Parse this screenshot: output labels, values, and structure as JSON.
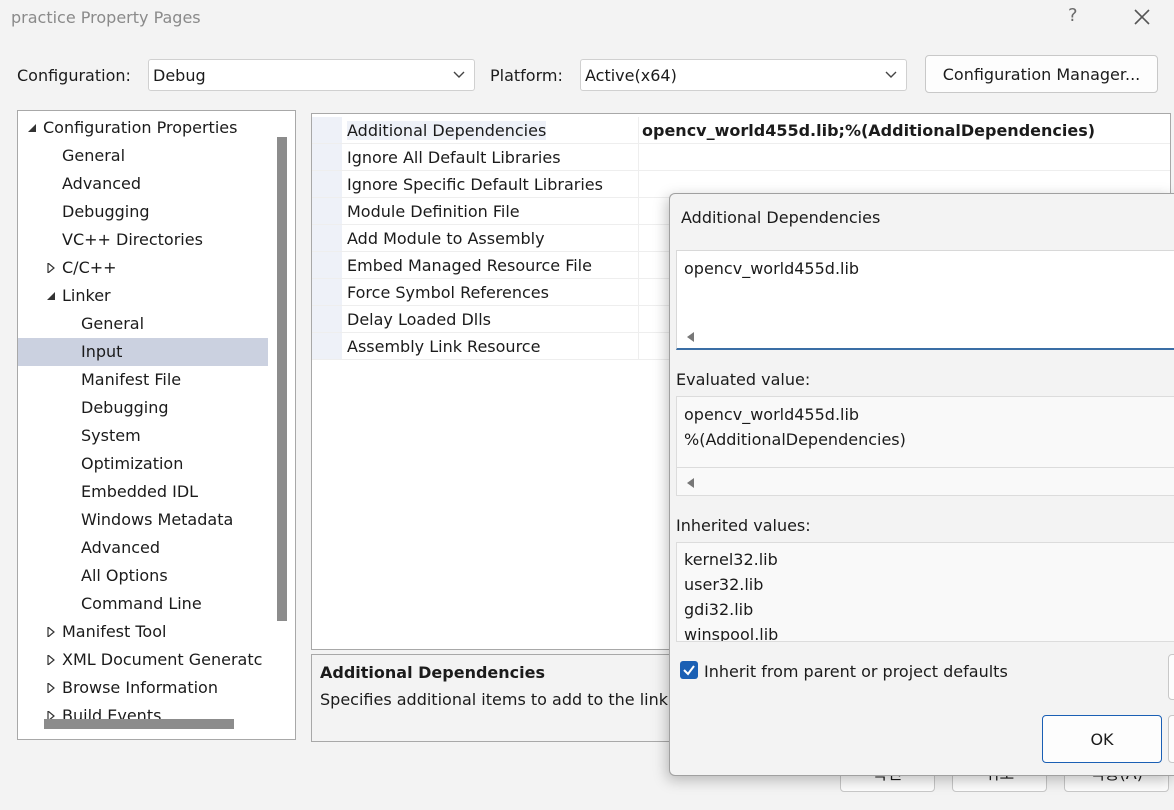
{
  "window": {
    "title": "practice Property Pages",
    "help_glyph": "?",
    "close_icon": "close-icon"
  },
  "config_bar": {
    "configuration_label": "Configuration:",
    "configuration_value": "Debug",
    "platform_label": "Platform:",
    "platform_value": "Active(x64)",
    "config_manager_label": "Configuration Manager..."
  },
  "tree": {
    "items": [
      "Configuration Properties",
      "General",
      "Advanced",
      "Debugging",
      "VC++ Directories",
      "C/C++",
      "Linker",
      "General",
      "Input",
      "Manifest File",
      "Debugging",
      "System",
      "Optimization",
      "Embedded IDL",
      "Windows Metadata",
      "Advanced",
      "All Options",
      "Command Line",
      "Manifest Tool",
      "XML Document Generatc",
      "Browse Information",
      "Build Events"
    ],
    "selected": "Input"
  },
  "grid": {
    "rows": [
      {
        "name": "Additional Dependencies",
        "value": "opencv_world455d.lib;%(AdditionalDependencies)"
      },
      {
        "name": "Ignore All Default Libraries",
        "value": ""
      },
      {
        "name": "Ignore Specific Default Libraries",
        "value": ""
      },
      {
        "name": "Module Definition File",
        "value": ""
      },
      {
        "name": "Add Module to Assembly",
        "value": ""
      },
      {
        "name": "Embed Managed Resource File",
        "value": ""
      },
      {
        "name": "Force Symbol References",
        "value": ""
      },
      {
        "name": "Delay Loaded Dlls",
        "value": ""
      },
      {
        "name": "Assembly Link Resource",
        "value": ""
      }
    ]
  },
  "description": {
    "title": "Additional Dependencies",
    "text": "Specifies additional items to add to the link"
  },
  "bottom_buttons": {
    "ok_ko": "확인",
    "cancel_ko": "취소",
    "apply_ko": "적용(A)"
  },
  "dialog": {
    "title": "Additional Dependencies",
    "edit_value": "opencv_world455d.lib",
    "evaluated_label": "Evaluated value:",
    "evaluated_lines": [
      "opencv_world455d.lib",
      "%(AdditionalDependencies)"
    ],
    "inherited_label": "Inherited values:",
    "inherited_lines": [
      "kernel32.lib",
      "user32.lib",
      "gdi32.lib",
      "winspool.lib"
    ],
    "inherit_checkbox_label": "Inherit from parent or project defaults",
    "inherit_checked": true,
    "ok_label": "OK"
  },
  "colors": {
    "selection": "#cbd1e0",
    "accent": "#1a5fb4"
  }
}
